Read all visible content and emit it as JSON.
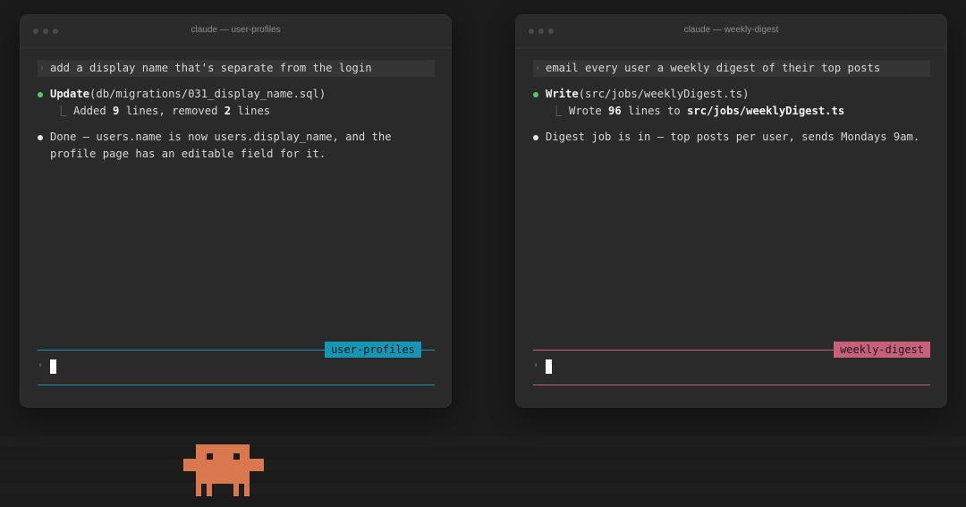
{
  "windows": [
    {
      "title": "claude — user-profiles",
      "prompt": "add a display name that's separate from the login",
      "tool_name": "Update",
      "tool_arg": "(db/migrations/031_display_name.sql)",
      "result_parts": [
        "Added ",
        "9",
        " lines, removed ",
        "2",
        " lines"
      ],
      "message_line1": "Done — users.name is now users.display_name, and the",
      "message_line2": "profile page has an editable field for it.",
      "session_tag": "user-profiles",
      "accent_color": "#1795b5"
    },
    {
      "title": "claude — weekly-digest",
      "prompt": "email every user a weekly digest of their top posts",
      "tool_name": "Write",
      "tool_arg": "(src/jobs/weeklyDigest.ts)",
      "result_parts": [
        "Wrote ",
        "96",
        " lines to ",
        "src/jobs/weeklyDigest.ts",
        ""
      ],
      "message_line1": "Digest job is in — top posts per user, sends Mondays 9am.",
      "message_line2": "",
      "session_tag": "weekly-digest",
      "accent_color": "#c7607b"
    }
  ],
  "icons": {
    "prompt_marker": "chevron-right-icon",
    "tool_status": "green-dot-icon",
    "message_status": "white-dot-icon",
    "result_connector": "tree-corner-icon",
    "mascot": "pixel-creature-icon"
  },
  "colors": {
    "background": "#1b1b1b",
    "window": "#2a2a2a",
    "success": "#5cc46d",
    "mascot": "#d9784e"
  }
}
